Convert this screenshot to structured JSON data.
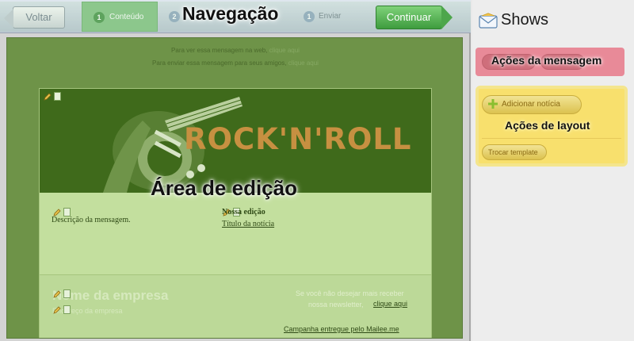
{
  "wizard": {
    "back_label": "Voltar",
    "step1_number": "1",
    "step1_label": "Conteúdo",
    "step2_number": "2",
    "step2_label": "Enviar",
    "continue_label": "Continuar",
    "overlay_title": "Navegação"
  },
  "canvas": {
    "preheader_line1": "Para ver essa mensagem na web,",
    "preheader_link1": "clique aqui",
    "preheader_line2": "Para enviar essa mensagem para seus amigos,",
    "preheader_link2": "clique aqui"
  },
  "email": {
    "banner_word": "ROCK'N'ROLL",
    "overlay_title": "Área de edição",
    "description": "Descrição da mensagem.",
    "news_label": "Nossa edição",
    "news_title_link": "Título da notícia",
    "company_name": "Nome da empresa",
    "company_address": "Endereço da empresa",
    "unsubscribe_line1": "Se você não desejar mais receber",
    "unsubscribe_line2": "nossa newsletter,",
    "unsubscribe_link": "clique aqui",
    "delivered_by": "Campanha entregue pelo Mailee.me"
  },
  "sidebar": {
    "title": "Shows",
    "icon": "envelope-icon",
    "message_actions_title": "Ações da mensagem",
    "add_news_label": "Adicionar notícia",
    "layout_actions_title": "Ações de layout",
    "change_template_label": "Trocar template"
  },
  "colors": {
    "green_overlay": "#6e9348",
    "red_overlay": "#e88a98",
    "yellow_overlay": "#f8e06d",
    "continue_green": "#4da64b"
  }
}
